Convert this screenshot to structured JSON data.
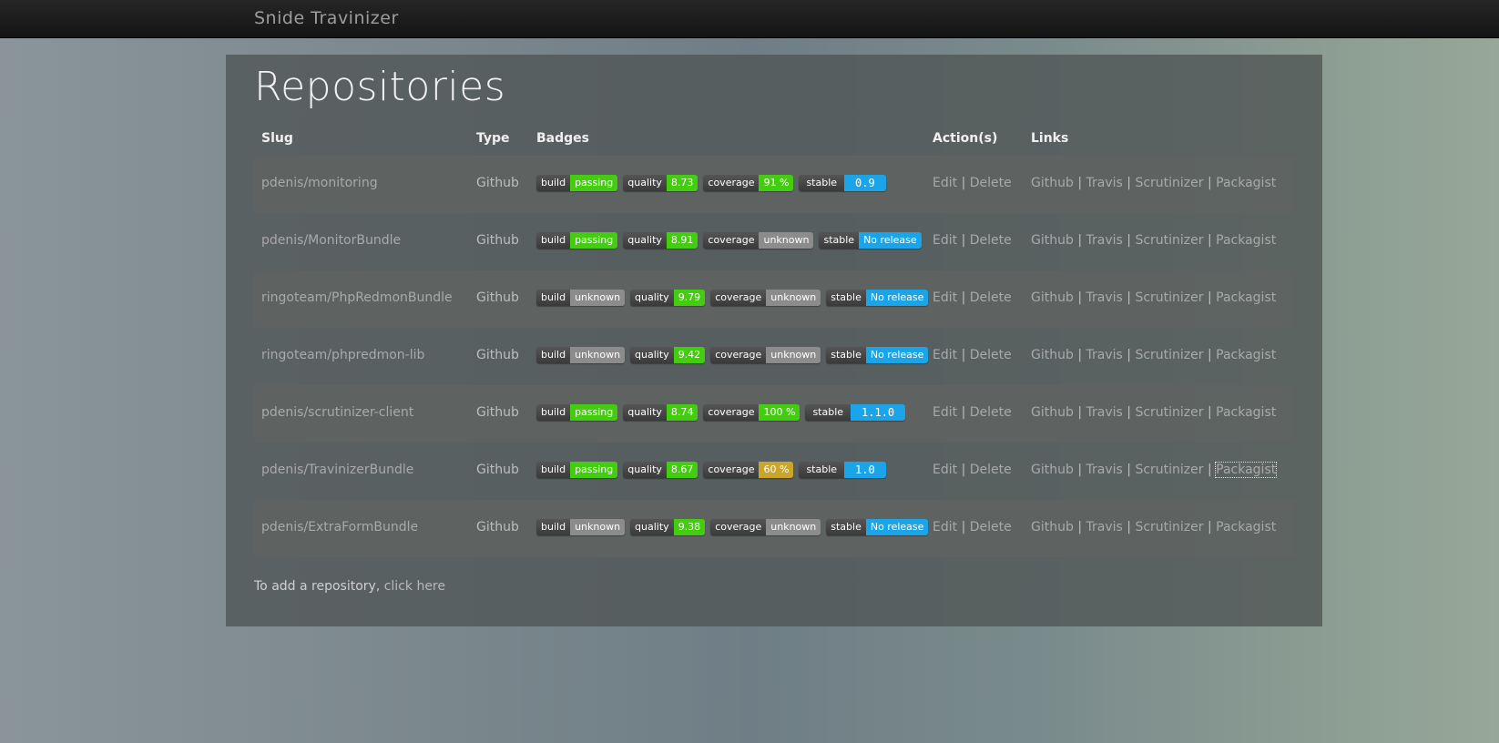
{
  "brand": "Snide Travinizer",
  "page_title": "Repositories",
  "columns": [
    "Slug",
    "Type",
    "Badges",
    "Action(s)",
    "Links"
  ],
  "colors": {
    "passing": "#44cc11",
    "unknown": "#8c8c8c",
    "coverage_mid": "#c9a52b",
    "release": "#1ca4e8"
  },
  "rows": [
    {
      "slug": "pdenis/monitoring",
      "type": "Github",
      "badges": [
        {
          "label": "build",
          "value": "passing",
          "color": "#44cc11"
        },
        {
          "label": "quality",
          "value": "8.73",
          "color": "#44cc11"
        },
        {
          "label": "coverage",
          "value": "91 %",
          "color": "#44cc11"
        },
        {
          "label": "stable",
          "value": "0.9",
          "color": "#1ca4e8",
          "wide": true
        }
      ]
    },
    {
      "slug": "pdenis/MonitorBundle",
      "type": "Github",
      "badges": [
        {
          "label": "build",
          "value": "passing",
          "color": "#44cc11"
        },
        {
          "label": "quality",
          "value": "8.91",
          "color": "#44cc11"
        },
        {
          "label": "coverage",
          "value": "unknown",
          "color": "#8c8c8c"
        },
        {
          "label": "stable",
          "value": "No release",
          "color": "#1ca4e8"
        }
      ]
    },
    {
      "slug": "ringoteam/PhpRedmonBundle",
      "type": "Github",
      "badges": [
        {
          "label": "build",
          "value": "unknown",
          "color": "#8c8c8c"
        },
        {
          "label": "quality",
          "value": "9.79",
          "color": "#44cc11"
        },
        {
          "label": "coverage",
          "value": "unknown",
          "color": "#8c8c8c"
        },
        {
          "label": "stable",
          "value": "No release",
          "color": "#1ca4e8"
        }
      ]
    },
    {
      "slug": "ringoteam/phpredmon-lib",
      "type": "Github",
      "badges": [
        {
          "label": "build",
          "value": "unknown",
          "color": "#8c8c8c"
        },
        {
          "label": "quality",
          "value": "9.42",
          "color": "#44cc11"
        },
        {
          "label": "coverage",
          "value": "unknown",
          "color": "#8c8c8c"
        },
        {
          "label": "stable",
          "value": "No release",
          "color": "#1ca4e8"
        }
      ]
    },
    {
      "slug": "pdenis/scrutinizer-client",
      "type": "Github",
      "badges": [
        {
          "label": "build",
          "value": "passing",
          "color": "#44cc11"
        },
        {
          "label": "quality",
          "value": "8.74",
          "color": "#44cc11"
        },
        {
          "label": "coverage",
          "value": "100 %",
          "color": "#44cc11"
        },
        {
          "label": "stable",
          "value": "1.1.0",
          "color": "#1ca4e8",
          "wide": true
        }
      ]
    },
    {
      "slug": "pdenis/TravinizerBundle",
      "type": "Github",
      "badges": [
        {
          "label": "build",
          "value": "passing",
          "color": "#44cc11"
        },
        {
          "label": "quality",
          "value": "8.67",
          "color": "#44cc11"
        },
        {
          "label": "coverage",
          "value": "60 %",
          "color": "#c9a52b"
        },
        {
          "label": "stable",
          "value": "1.0",
          "color": "#1ca4e8",
          "wide": true
        }
      ]
    },
    {
      "slug": "pdenis/ExtraFormBundle",
      "type": "Github",
      "badges": [
        {
          "label": "build",
          "value": "unknown",
          "color": "#8c8c8c"
        },
        {
          "label": "quality",
          "value": "9.38",
          "color": "#44cc11"
        },
        {
          "label": "coverage",
          "value": "unknown",
          "color": "#8c8c8c"
        },
        {
          "label": "stable",
          "value": "No release",
          "color": "#1ca4e8"
        }
      ]
    }
  ],
  "actions": {
    "edit": "Edit",
    "delete": "Delete",
    "separator": "|"
  },
  "links": {
    "github": "Github",
    "travis": "Travis",
    "scrutinizer": "Scrutinizer",
    "packagist": "Packagist"
  },
  "footer": {
    "text": "To add a repository,",
    "link": "click here"
  }
}
